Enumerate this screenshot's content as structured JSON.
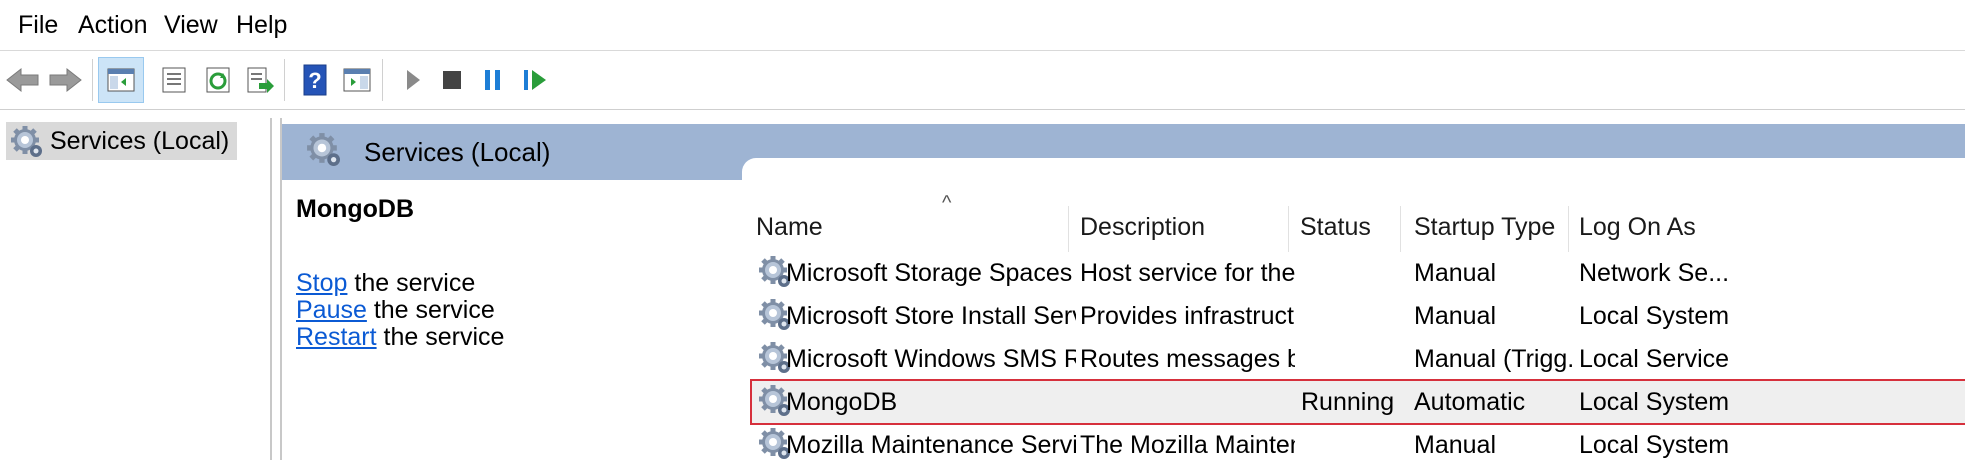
{
  "menu": [
    "File",
    "Action",
    "View",
    "Help"
  ],
  "tree": {
    "root_label": "Services (Local)"
  },
  "header": {
    "title": "Services (Local)"
  },
  "detail": {
    "service_name": "MongoDB",
    "actions": [
      {
        "link": "Stop",
        "rest": " the service"
      },
      {
        "link": "Pause",
        "rest": " the service"
      },
      {
        "link": "Restart",
        "rest": " the service"
      }
    ]
  },
  "columns": [
    "Name",
    "Description",
    "Status",
    "Startup Type",
    "Log On As"
  ],
  "rows": [
    {
      "name": "Microsoft Storage Spaces SMP",
      "description": "Host service for the ...",
      "status": "",
      "startup": "Manual",
      "logon": "Network Se..."
    },
    {
      "name": "Microsoft Store Install Service",
      "description": "Provides infrastructu...",
      "status": "",
      "startup": "Manual",
      "logon": "Local System"
    },
    {
      "name": "Microsoft Windows SMS Rou...",
      "description": "Routes messages b...",
      "status": "",
      "startup": "Manual (Trigg...",
      "logon": "Local Service"
    },
    {
      "name": "MongoDB",
      "description": "",
      "status": "Running",
      "startup": "Automatic",
      "logon": "Local System"
    },
    {
      "name": "Mozilla Maintenance Service",
      "description": "The Mozilla Mainten...",
      "status": "",
      "startup": "Manual",
      "logon": "Local System"
    }
  ],
  "icons": {
    "toolbar": [
      "back-arrow-icon",
      "forward-arrow-icon",
      "show-hide-console-tree-icon",
      "properties-icon",
      "refresh-icon",
      "export-list-icon",
      "help-icon",
      "show-action-pane-icon",
      "start-service-icon",
      "stop-service-icon",
      "pause-service-icon",
      "resume-service-icon"
    ]
  },
  "colors": {
    "header_band": "#9eb4d3",
    "selection_outline": "#d6303c",
    "link": "#0b5ad4",
    "play_green": "#2a9d3a",
    "pause_blue": "#1d7ed6"
  }
}
